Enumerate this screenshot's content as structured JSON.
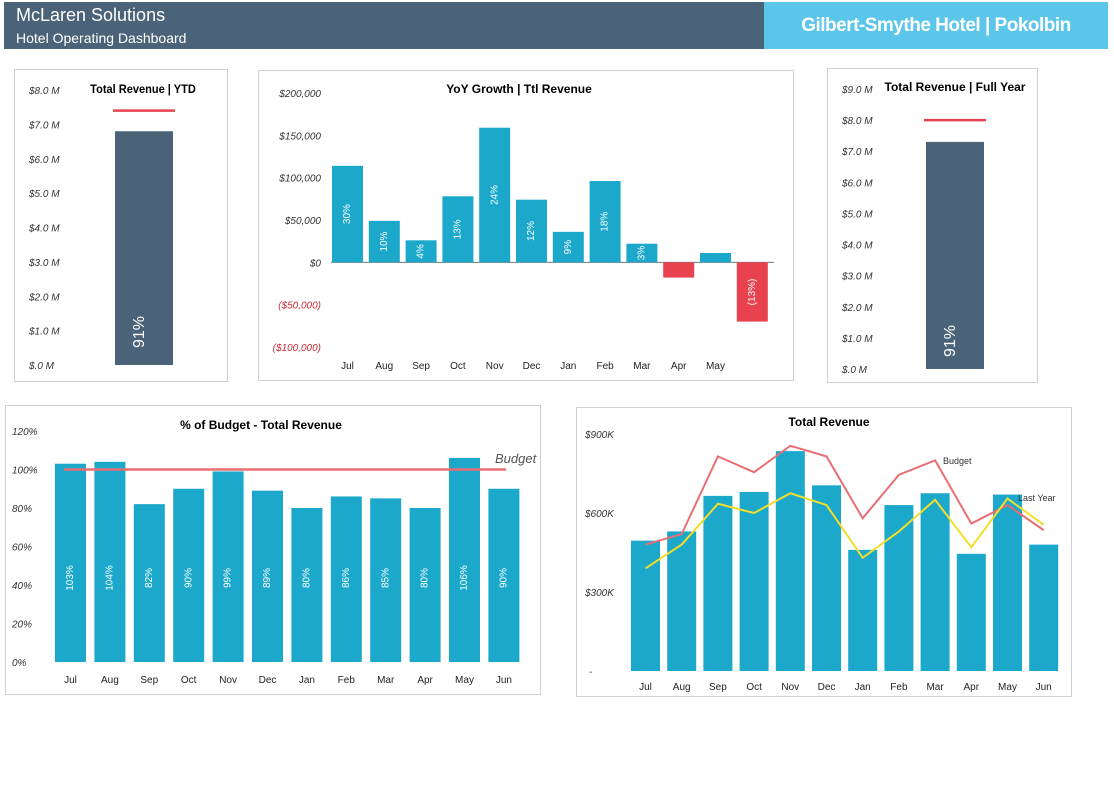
{
  "header": {
    "company": "McLaren Solutions",
    "subtitle": "Hotel Operating Dashboard",
    "hotel": "Gilbert-Smythe Hotel | Pokolbin"
  },
  "colors": {
    "navy": "#4a6379",
    "teal": "#1ba8cb",
    "red": "#e8424f",
    "budget_line": "#e86e72",
    "lastyear_line": "#f2de2a",
    "header_accent": "#5cc6ea"
  },
  "chart_data": [
    {
      "id": "ytd",
      "type": "bar",
      "title": "Total Revenue | YTD",
      "y_ticks": [
        "$8.0 M",
        "$7.0 M",
        "$6.0 M",
        "$5.0 M",
        "$4.0 M",
        "$3.0 M",
        "$2.0 M",
        "$1.0 M",
        "$.0 M"
      ],
      "ylim": [
        0,
        8
      ],
      "values": [
        6.8
      ],
      "budget": 7.4,
      "bar_label": "91%"
    },
    {
      "id": "yoy",
      "type": "bar",
      "title": "YoY Growth | Ttl Revenue",
      "y_ticks": [
        "$200,000",
        "$150,000",
        "$100,000",
        "$50,000",
        "$0",
        "($50,000)",
        "($100,000)"
      ],
      "ylim": [
        -100000,
        200000
      ],
      "categories": [
        "Jul",
        "Aug",
        "Sep",
        "Oct",
        "Nov",
        "Dec",
        "Jan",
        "Feb",
        "Mar",
        "Apr",
        "May"
      ],
      "values": [
        114000,
        49000,
        26000,
        78000,
        159000,
        74000,
        36000,
        96000,
        22000,
        -18000,
        11000,
        -70000
      ],
      "bar_labels": [
        "30%",
        "10%",
        "4%",
        "13%",
        "24%",
        "12%",
        "9%",
        "18%",
        "3%",
        "",
        "",
        "(13%)"
      ]
    },
    {
      "id": "fullyear",
      "type": "bar",
      "title": "Total Revenue | Full Year",
      "y_ticks": [
        "$9.0 M",
        "$8.0 M",
        "$7.0 M",
        "$6.0 M",
        "$5.0 M",
        "$4.0 M",
        "$3.0 M",
        "$2.0 M",
        "$1.0 M",
        "$.0 M"
      ],
      "ylim": [
        0,
        9
      ],
      "values": [
        7.3
      ],
      "budget": 8.0,
      "bar_label": "91%"
    },
    {
      "id": "budgetpct",
      "type": "bar",
      "title": "% of Budget - Total Revenue",
      "y_ticks": [
        "120%",
        "100%",
        "80%",
        "60%",
        "40%",
        "20%",
        "0%"
      ],
      "ylim": [
        0,
        120
      ],
      "categories": [
        "Jul",
        "Aug",
        "Sep",
        "Oct",
        "Nov",
        "Dec",
        "Jan",
        "Feb",
        "Mar",
        "Apr",
        "May",
        "Jun"
      ],
      "values": [
        103,
        104,
        82,
        90,
        99,
        89,
        80,
        86,
        85,
        80,
        106,
        90
      ],
      "bar_labels": [
        "103%",
        "104%",
        "82%",
        "90%",
        "99%",
        "89%",
        "80%",
        "86%",
        "85%",
        "80%",
        "106%",
        "90%"
      ],
      "budget_value": 100,
      "budget_label": "Budget"
    },
    {
      "id": "totalrev",
      "type": "bar",
      "title": "Total Revenue",
      "y_ticks": [
        "$900K",
        "$600K",
        "$300K",
        "-"
      ],
      "ylim": [
        0,
        900
      ],
      "categories": [
        "Jul",
        "Aug",
        "Sep",
        "Oct",
        "Nov",
        "Dec",
        "Jan",
        "Feb",
        "Mar",
        "Apr",
        "May",
        "Jun"
      ],
      "series": [
        {
          "name": "Actual",
          "values": [
            495,
            530,
            665,
            680,
            835,
            705,
            460,
            630,
            675,
            445,
            670,
            480
          ]
        },
        {
          "name": "Budget",
          "values": [
            480,
            520,
            815,
            755,
            855,
            815,
            580,
            745,
            800,
            560,
            630,
            535
          ]
        },
        {
          "name": "Last Year",
          "values": [
            390,
            480,
            635,
            600,
            675,
            630,
            430,
            530,
            650,
            470,
            655,
            555
          ]
        }
      ],
      "budget_label": "Budget",
      "lastyear_label": "Last Year"
    }
  ]
}
